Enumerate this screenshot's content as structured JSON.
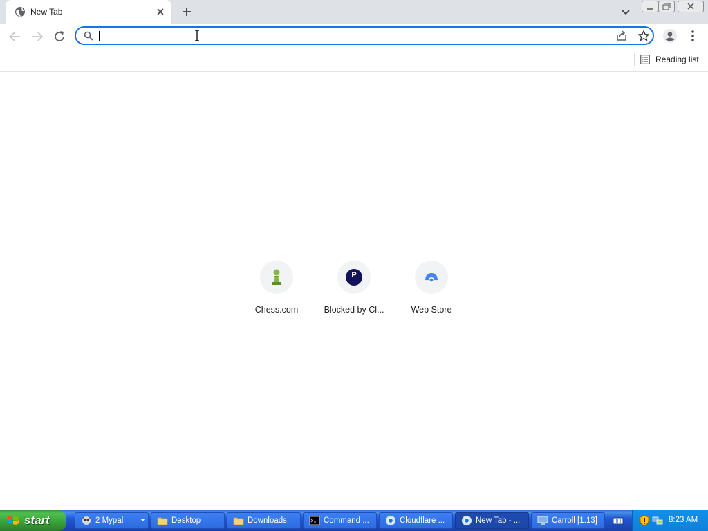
{
  "browser": {
    "tab": {
      "title": "New Tab"
    },
    "omnibox": {
      "value": "",
      "placeholder": ""
    },
    "bookmarks_bar": {
      "reading_list_label": "Reading list"
    }
  },
  "new_tab_page": {
    "shortcuts": [
      {
        "label": "Chess.com",
        "icon": "chess-pawn-icon"
      },
      {
        "label": "Blocked by Cl...",
        "icon": "letter-p-icon",
        "letter": "P"
      },
      {
        "label": "Web Store",
        "icon": "web-store-icon"
      }
    ]
  },
  "taskbar": {
    "start_label": "start",
    "buttons": [
      {
        "label": "2 Mypal",
        "icon": "mypal-icon",
        "active": false,
        "group": true
      },
      {
        "label": "Desktop",
        "icon": "folder-icon",
        "active": false
      },
      {
        "label": "Downloads",
        "icon": "folder-icon",
        "active": false
      },
      {
        "label": "Command ...",
        "icon": "command-prompt-icon",
        "active": false
      },
      {
        "label": "Cloudflare ...",
        "icon": "chrome-icon",
        "active": false
      },
      {
        "label": "New Tab - ...",
        "icon": "chrome-icon",
        "active": true
      },
      {
        "label": "Carroll [1.13]",
        "icon": "monitor-icon",
        "active": false
      }
    ],
    "clock": "8:23 AM"
  },
  "colors": {
    "accent": "#1a73e8",
    "tabstrip_bg": "#dee1e6",
    "taskbar_blue": "#245edb",
    "start_green": "#3c9a3c"
  }
}
